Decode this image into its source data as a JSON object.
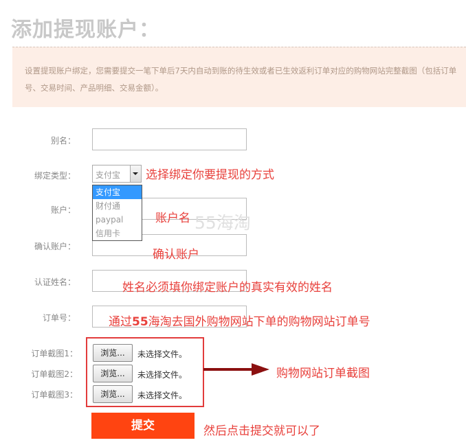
{
  "page_title": "添加提现账户：",
  "notice": "设置提现账户绑定，您需要提交一笔下单后7天内自动到账的待生效或者已生效返利订单对应的购物网站完整截图（包括订单号、交易时间、产品明细、交易金额）。",
  "form": {
    "alias_label": "别名：",
    "bind_type_label": "绑定类型：",
    "bind_type_value": "支付宝",
    "bind_type_options": [
      "支付宝",
      "财付通",
      "paypal",
      "信用卡"
    ],
    "account_label": "账户：",
    "confirm_account_label": "确认账户：",
    "real_name_label": "认证姓名：",
    "order_no_label": "订单号：",
    "screenshots": [
      {
        "label": "订单截图1：",
        "button": "浏览...",
        "status": "未选择文件。"
      },
      {
        "label": "订单截图2：",
        "button": "浏览...",
        "status": "未选择文件。"
      },
      {
        "label": "订单截图3：",
        "button": "浏览...",
        "status": "未选择文件。"
      }
    ],
    "submit_label": "提交"
  },
  "annotations": {
    "bind_type": "选择绑定你要提现的方式",
    "account": "账户名",
    "confirm_account": "确认账户",
    "real_name": "姓名必须填你绑定账户的真实有效的姓名",
    "order_no_prefix": "通过",
    "order_no_bold": "55",
    "order_no_suffix": "海淘去国外购物网站下单的购物网站订单号",
    "screenshots": "购物网站订单截图",
    "submit": "然后点击提交就可以了"
  },
  "watermark": "55海淘",
  "colors": {
    "annotation_red": "#e8413c",
    "submit_orange": "#ff4411",
    "notice_bg": "#fdeee6",
    "selected_option": "#3399ff",
    "arrow": "#8b1010"
  }
}
